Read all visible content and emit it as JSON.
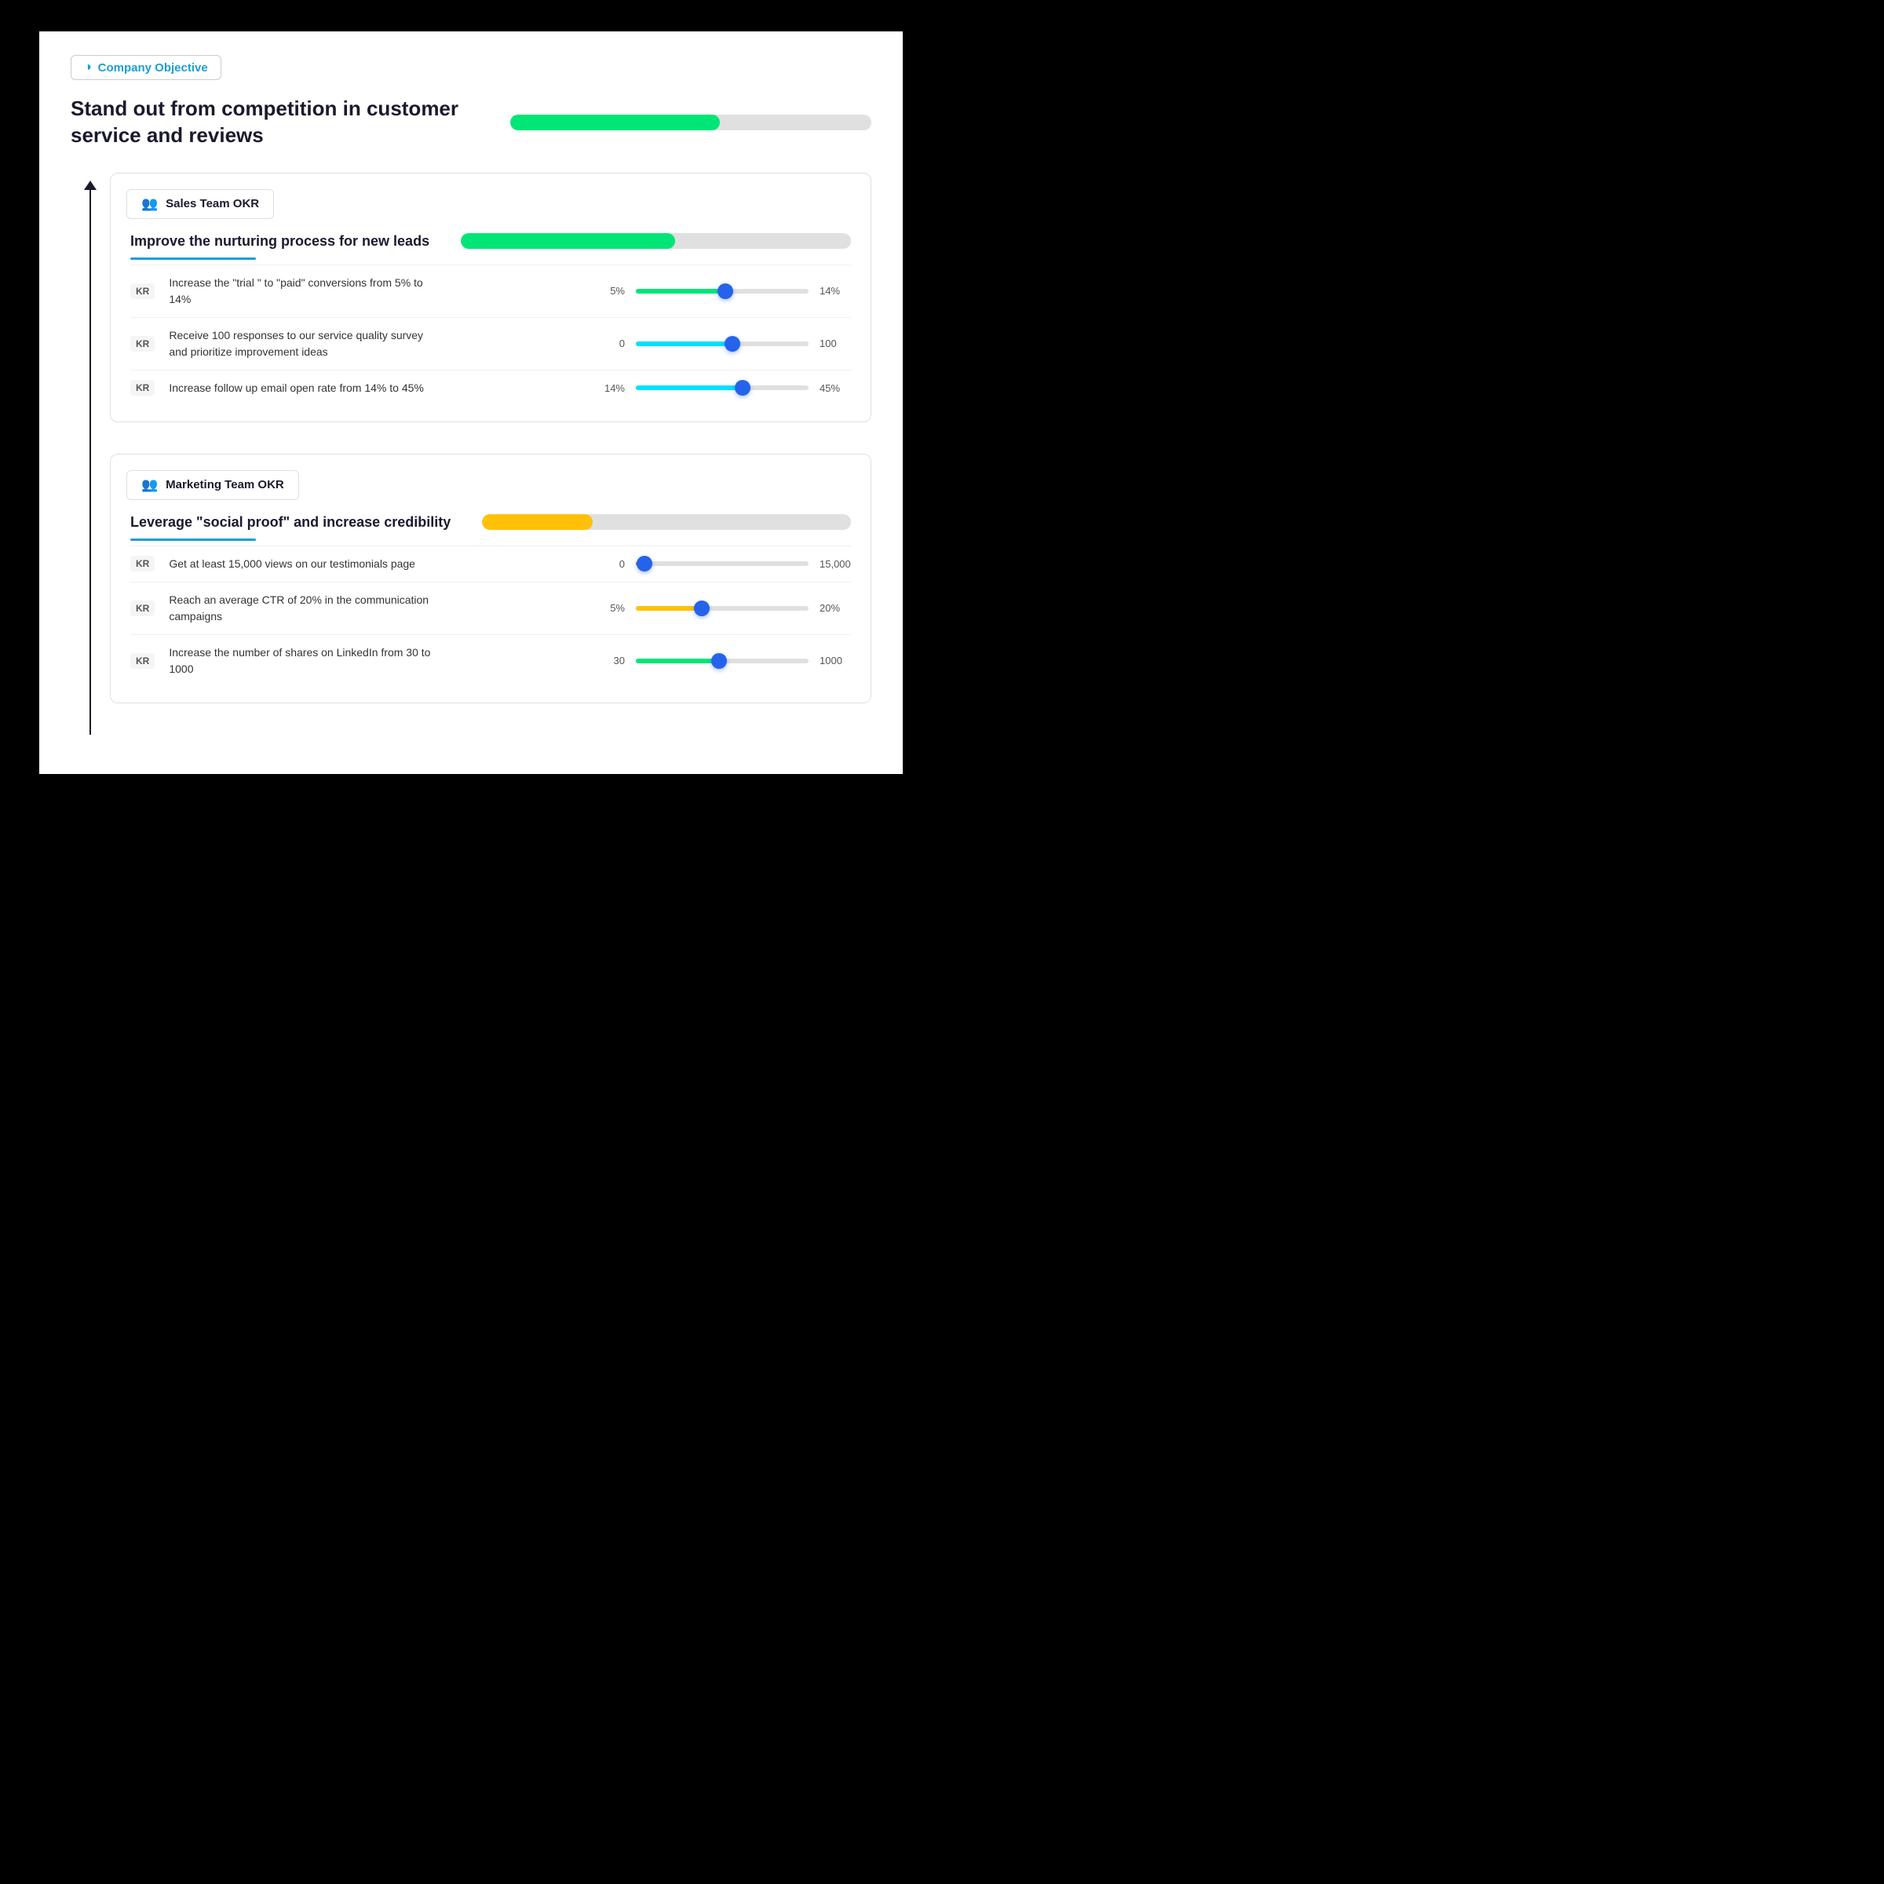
{
  "companyObjective": {
    "badgeLabel": "Company Objective",
    "title": "Stand out from competition in customer service and reviews",
    "progressPercent": 58,
    "progressColor": "#00e676",
    "progressTrackColor": "#e0e0e0"
  },
  "salesTeamOKR": {
    "teamLabel": "Sales Team OKR",
    "objectiveTitle": "Improve the nurturing process for new leads",
    "objectiveProgressPercent": 55,
    "objectiveProgressColor": "#00e676",
    "keyResults": [
      {
        "id": "kr1",
        "badge": "KR",
        "description": "Increase the \"trial \" to \"paid\" conversions from 5% to 14%",
        "minLabel": "5%",
        "maxLabel": "14%",
        "fillPercent": 52,
        "fillColor": "#00e676"
      },
      {
        "id": "kr2",
        "badge": "KR",
        "description": "Receive 100 responses to our service quality survey and prioritize improvement ideas",
        "minLabel": "0",
        "maxLabel": "100",
        "fillPercent": 56,
        "fillColor": "#00e0ff"
      },
      {
        "id": "kr3",
        "badge": "KR",
        "description": "Increase follow up email open rate from 14% to 45%",
        "minLabel": "14%",
        "maxLabel": "45%",
        "fillPercent": 62,
        "fillColor": "#00e0ff"
      }
    ]
  },
  "marketingTeamOKR": {
    "teamLabel": "Marketing Team OKR",
    "objectiveTitle": "Leverage \"social proof\" and increase credibility",
    "objectiveProgressPercent": 30,
    "objectiveProgressColor": "#ffc107",
    "keyResults": [
      {
        "id": "kr4",
        "badge": "KR",
        "description": "Get at least 15,000 views on our testimonials page",
        "minLabel": "0",
        "maxLabel": "15,000",
        "fillPercent": 5,
        "fillColor": "#f44336"
      },
      {
        "id": "kr5",
        "badge": "KR",
        "description": "Reach an average CTR of 20% in the communication campaigns",
        "minLabel": "5%",
        "maxLabel": "20%",
        "fillPercent": 38,
        "fillColor": "#ffc107"
      },
      {
        "id": "kr6",
        "badge": "KR",
        "description": "Increase the number of shares on LinkedIn from 30 to 1000",
        "minLabel": "30",
        "maxLabel": "1000",
        "fillPercent": 48,
        "fillColor": "#00e676"
      }
    ]
  },
  "icons": {
    "companyObjectiveIcon": "◑",
    "teamIcon": "👥"
  }
}
